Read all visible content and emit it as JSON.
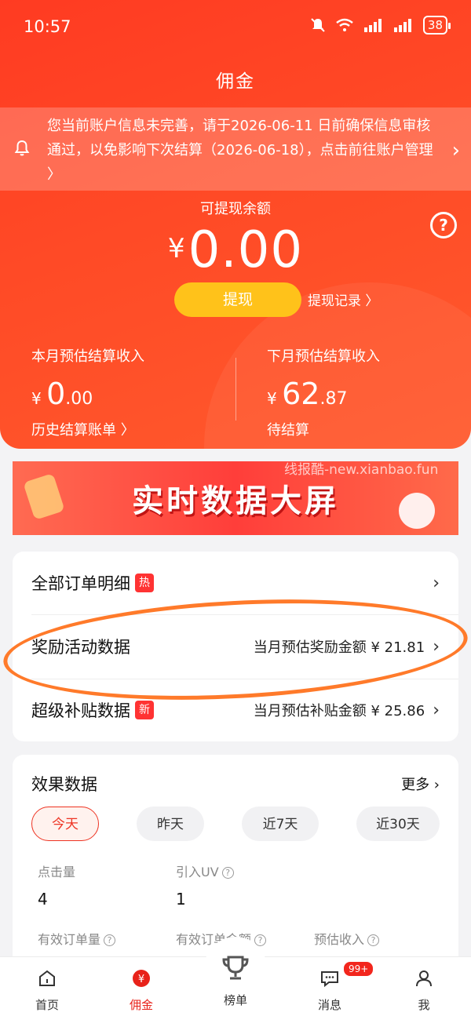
{
  "status_bar": {
    "time": "10:57",
    "battery": "38"
  },
  "header": {
    "title": "佣金"
  },
  "notice": {
    "text": "您当前账户信息未完善，请于2026-06-11 日前确保信息审核通过，以免影响下次结算（2026-06-18），点击前往账户管理 〉"
  },
  "balance": {
    "label": "可提现余额",
    "currency": "¥",
    "amount": "0.00",
    "withdraw_button": "提现",
    "withdraw_record": "提现记录 〉"
  },
  "this_month": {
    "label": "本月预估结算收入",
    "currency": "¥",
    "int": "0",
    "dec": ".00",
    "link": "历史结算账单 〉"
  },
  "next_month": {
    "label": "下月预估结算收入",
    "currency": "¥",
    "int": "62",
    "dec": ".87",
    "link": "待结算"
  },
  "banner": {
    "title": "实时数据大屏",
    "watermark": "线报酷-new.xianbao.fun"
  },
  "orders": {
    "all_orders": {
      "label": "全部订单明细",
      "badge": "热"
    },
    "reward": {
      "label": "奖励活动数据",
      "right": "当月预估奖励金额 ¥ 21.81"
    },
    "subsidy": {
      "label": "超级补贴数据",
      "badge": "新",
      "right": "当月预估补贴金额 ¥ 25.86"
    }
  },
  "effect": {
    "title": "效果数据",
    "more": "更多 ›",
    "tabs": [
      "今天",
      "昨天",
      "近7天",
      "近30天"
    ],
    "metrics": [
      {
        "label": "点击量",
        "value": "4"
      },
      {
        "label": "引入UV",
        "value": "1"
      },
      {
        "label": "有效订单量",
        "value": ""
      },
      {
        "label": "有效订单金额",
        "value": ""
      },
      {
        "label": "预估收入",
        "value": ""
      }
    ]
  },
  "nav": {
    "items": [
      "首页",
      "佣金",
      "榜单",
      "消息",
      "我"
    ],
    "message_badge": "99+"
  },
  "colors": {
    "brand": "#ff4a26",
    "accent_yellow": "#ffc21a",
    "active_red": "#e8221a"
  }
}
